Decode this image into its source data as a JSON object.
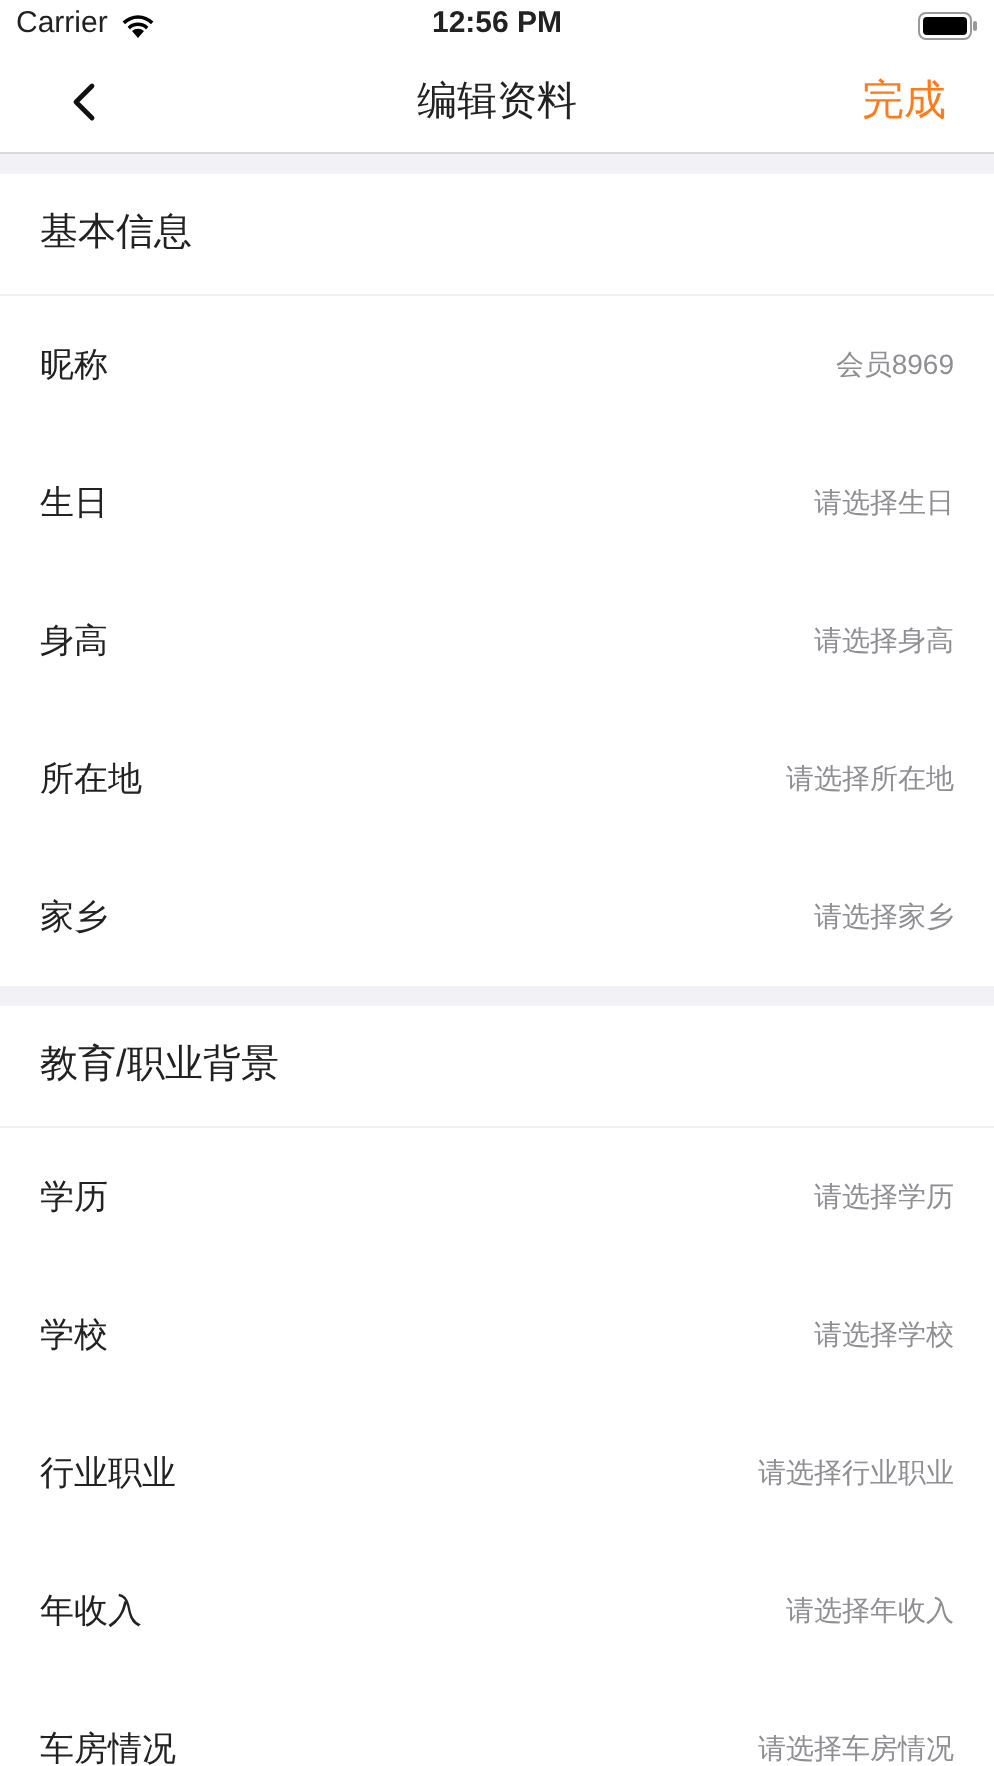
{
  "status_bar": {
    "carrier": "Carrier",
    "time": "12:56 PM"
  },
  "nav": {
    "title": "编辑资料",
    "action": "完成"
  },
  "sections": [
    {
      "title": "基本信息",
      "rows": [
        {
          "label": "昵称",
          "value": "会员8969"
        },
        {
          "label": "生日",
          "value": "请选择生日"
        },
        {
          "label": "身高",
          "value": "请选择身高"
        },
        {
          "label": "所在地",
          "value": "请选择所在地"
        },
        {
          "label": "家乡",
          "value": "请选择家乡"
        }
      ]
    },
    {
      "title": "教育/职业背景",
      "rows": [
        {
          "label": "学历",
          "value": "请选择学历"
        },
        {
          "label": "学校",
          "value": "请选择学校"
        },
        {
          "label": "行业职业",
          "value": "请选择行业职业"
        },
        {
          "label": "年收入",
          "value": "请选择年收入"
        },
        {
          "label": "车房情况",
          "value": "请选择车房情况"
        }
      ]
    }
  ]
}
